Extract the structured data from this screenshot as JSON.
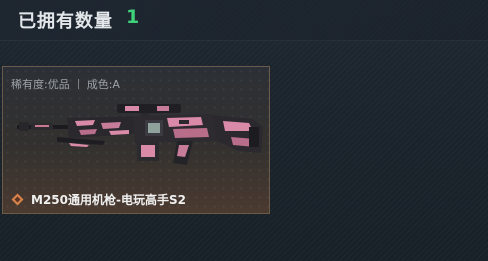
{
  "header": {
    "title": "已拥有数量",
    "count": "1"
  },
  "card": {
    "rarity": "稀有度:优品",
    "quality": "成色:A",
    "item_name": "M250通用机枪-电玩高手S2",
    "icon": "diamond-badge-icon",
    "image": "pink-camo-machine-gun"
  },
  "colors": {
    "count_green": "#3fd07a",
    "card_border": "#6a5a49",
    "weapon_pink": "#d98aa6",
    "icon_orange": "#d9824a"
  }
}
